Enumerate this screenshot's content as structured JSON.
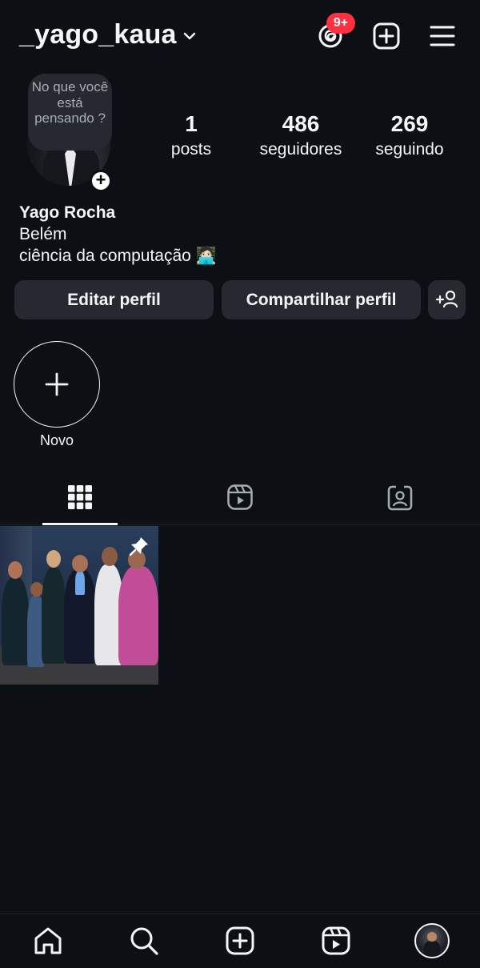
{
  "header": {
    "username": "_yago_kaua",
    "threads_badge": "9+",
    "icons": [
      "chevron-down-icon",
      "threads-icon",
      "create-icon",
      "menu-icon"
    ]
  },
  "profile": {
    "note_text": "No que você está pensando ?",
    "note_add_icon": "+",
    "stats": [
      {
        "value": "1",
        "label": "posts"
      },
      {
        "value": "486",
        "label": "seguidores"
      },
      {
        "value": "269",
        "label": "seguindo"
      }
    ],
    "name": "Yago Rocha",
    "bio_lines": [
      "Belém",
      "ciência da computação 🧑🏻‍💻"
    ]
  },
  "buttons": {
    "edit": "Editar perfil",
    "share": "Compartilhar perfil"
  },
  "highlights": {
    "new_label": "Novo"
  },
  "tabs": [
    "grid-icon",
    "reels-icon",
    "tagged-icon"
  ],
  "posts": [
    {
      "pinned": true,
      "description_icon": "pin-icon"
    }
  ],
  "bottom_nav": [
    "home-icon",
    "search-icon",
    "create-icon",
    "reels-icon",
    "profile-avatar"
  ],
  "colors": {
    "background": "#0c1014",
    "button": "#26292f",
    "badge": "#ff3040",
    "text": "#f5f5f5"
  }
}
